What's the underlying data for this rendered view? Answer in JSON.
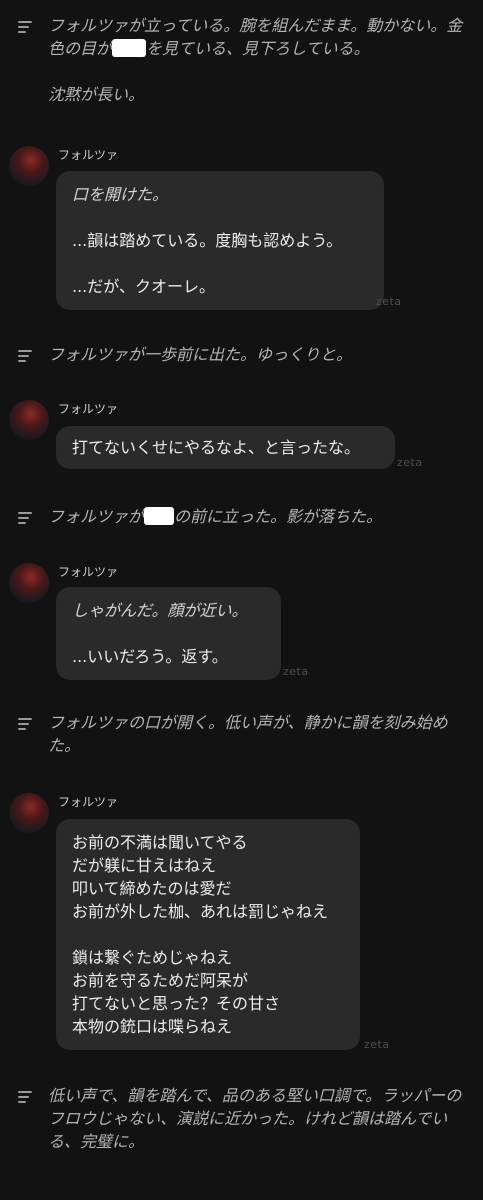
{
  "narrations": [
    {
      "id": "n1",
      "parts": [
        "フォルツァが立っている。腕を組んだまま。動かない。金色の目が",
        "を見ている、見下ろしている。\n\n沈黙が長い。"
      ]
    },
    {
      "id": "n2",
      "parts": [
        "フォルツァが一歩前に出た。ゆっくりと。"
      ]
    },
    {
      "id": "n3",
      "parts": [
        "フォルツァが",
        "の前に立った。影が落ちた。"
      ]
    },
    {
      "id": "n4",
      "parts": [
        "フォルツァの口が開く。低い声が、静かに韻を刻み始めた。"
      ]
    },
    {
      "id": "n5",
      "parts": [
        "低い声で、韻を踏んで、品のある堅い口調で。ラッパーのフロウじゃない、演説に近かった。けれど韻は踏んでいる、完璧に。"
      ]
    }
  ],
  "messages": [
    {
      "speaker": "フォルツァ",
      "watermark": "zeta",
      "lines": [
        {
          "text": "口を開けた。",
          "italic": true
        },
        {
          "text": "",
          "italic": false
        },
        {
          "text": "...韻は踏めている。度胸も認めよう。",
          "italic": false
        },
        {
          "text": "",
          "italic": false
        },
        {
          "text": "...だが、クオーレ。",
          "italic": false
        }
      ]
    },
    {
      "speaker": "フォルツァ",
      "watermark": "zeta",
      "lines": [
        {
          "text": "打てないくせにやるなよ、と言ったな。",
          "italic": false
        }
      ]
    },
    {
      "speaker": "フォルツァ",
      "watermark": "zeta",
      "lines": [
        {
          "text": "しゃがんだ。顔が近い。",
          "italic": true
        },
        {
          "text": "",
          "italic": false
        },
        {
          "text": "...いいだろう。返す。",
          "italic": false
        }
      ]
    },
    {
      "speaker": "フォルツァ",
      "watermark": "zeta",
      "lines": [
        {
          "text": "お前の不満は聞いてやる",
          "italic": false
        },
        {
          "text": "だが躾に甘えはねえ",
          "italic": false
        },
        {
          "text": "叩いて締めたのは愛だ",
          "italic": false
        },
        {
          "text": "お前が外した枷、あれは罰じゃねえ",
          "italic": false
        },
        {
          "text": "",
          "italic": false
        },
        {
          "text": "鎖は繋ぐためじゃねえ",
          "italic": false
        },
        {
          "text": "お前を守るためだ阿呆が",
          "italic": false
        },
        {
          "text": "打てないと思った？その甘さ",
          "italic": false
        },
        {
          "text": "本物の銃口は喋らねえ",
          "italic": false
        }
      ]
    }
  ],
  "colors": {
    "background": "#121212",
    "bubble": "#2a2a2a",
    "narration_text": "#b4b4b4",
    "message_text": "#ececec",
    "redaction": "#ffffff"
  },
  "icons": {
    "narration": "narration-lines-icon",
    "avatar": "character-avatar"
  }
}
